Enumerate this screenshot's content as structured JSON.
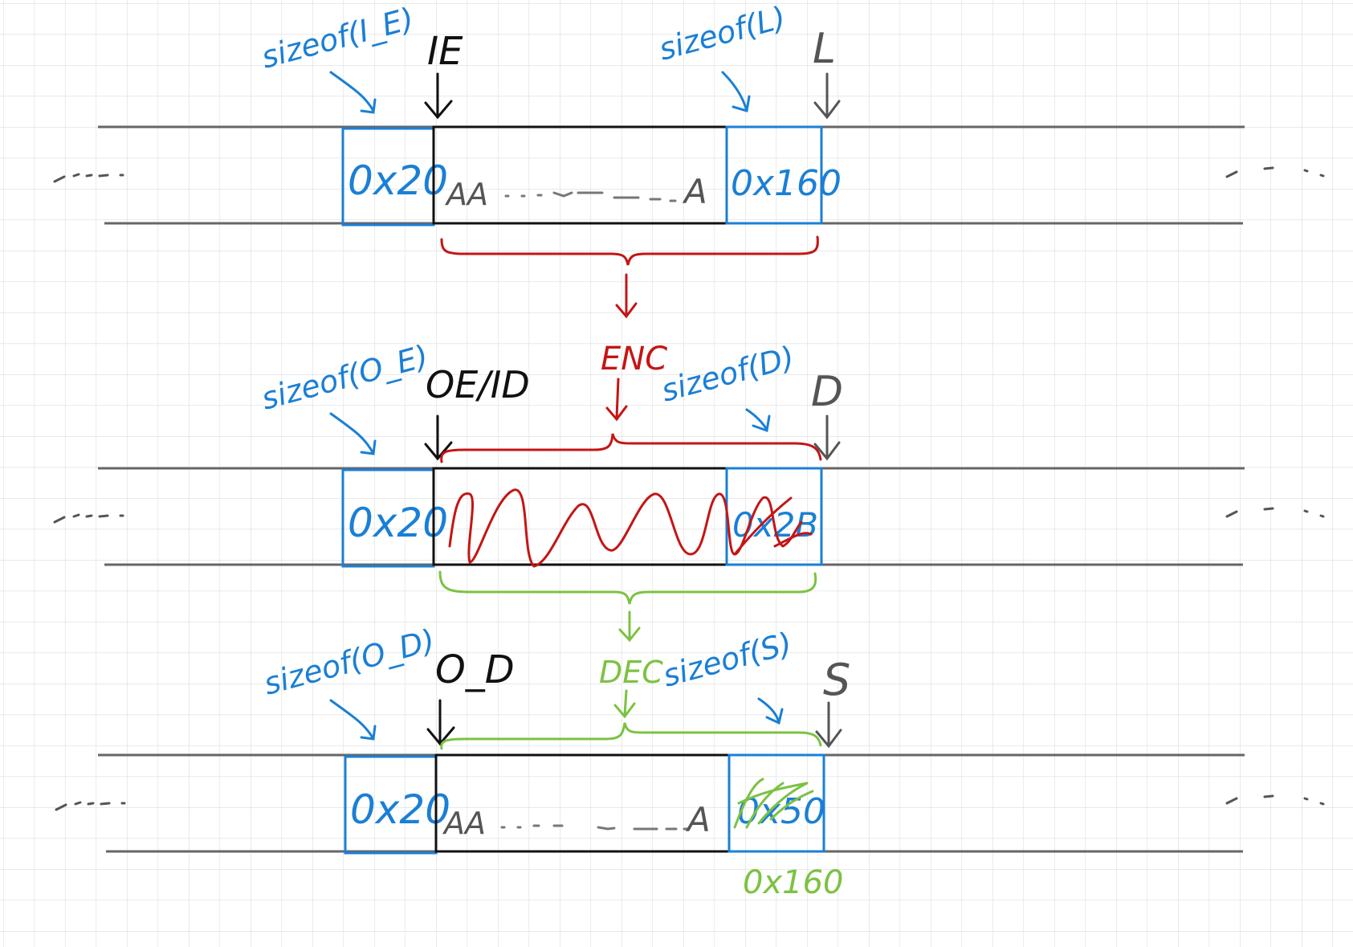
{
  "colors": {
    "blue": "#1a7fd6",
    "black": "#111111",
    "gray": "#555555",
    "red": "#c41515",
    "green": "#7cc242",
    "grid": "#dcdcdc"
  },
  "top_row": {
    "size_label": "sizeof(I_E)",
    "pointer_label": "IE",
    "right_size_label": "sizeof(L)",
    "right_pointer_label": "L",
    "chunk_header": "0x20",
    "data_start": "AA",
    "data_end": "A",
    "next_header": "0x160"
  },
  "enc_label": "ENC",
  "middle_row": {
    "size_label": "sizeof(O_E)",
    "pointer_label": "OE/ID",
    "right_size_label": "sizeof(D)",
    "right_pointer_label": "D",
    "chunk_header": "0x20",
    "next_header_scribbled": "0x2B"
  },
  "dec_label": "DEC",
  "bottom_row": {
    "size_label": "sizeof(O_D)",
    "pointer_label": "O_D",
    "right_size_label": "sizeof(S)",
    "right_pointer_label": "S",
    "chunk_header": "0x20",
    "data_start": "AA",
    "data_end": "A",
    "next_header_scribbled": "0x50",
    "next_header_corrected": "0x160"
  }
}
